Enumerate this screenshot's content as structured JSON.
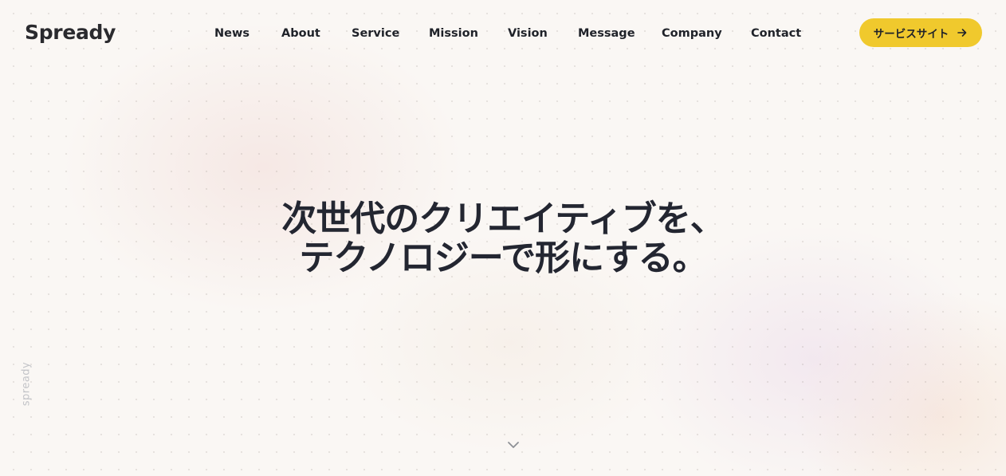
{
  "header": {
    "logo": "Spready",
    "nav": [
      {
        "label": "News"
      },
      {
        "label": "About"
      },
      {
        "label": "Service"
      },
      {
        "label": "Mission"
      },
      {
        "label": "Vision"
      },
      {
        "label": "Message"
      },
      {
        "label": "Company"
      },
      {
        "label": "Contact"
      }
    ],
    "cta_label": "サービスサイト"
  },
  "hero": {
    "line1": "次世代のクリエイティブを、",
    "line2": "テクノロジーで形にする。"
  },
  "side_label": "spready",
  "colors": {
    "accent": "#f0c92d",
    "text": "#232631",
    "background": "#faf7f4"
  },
  "icons": {
    "cta": "arrow-right-icon",
    "scroll": "chevron-down-icon"
  }
}
